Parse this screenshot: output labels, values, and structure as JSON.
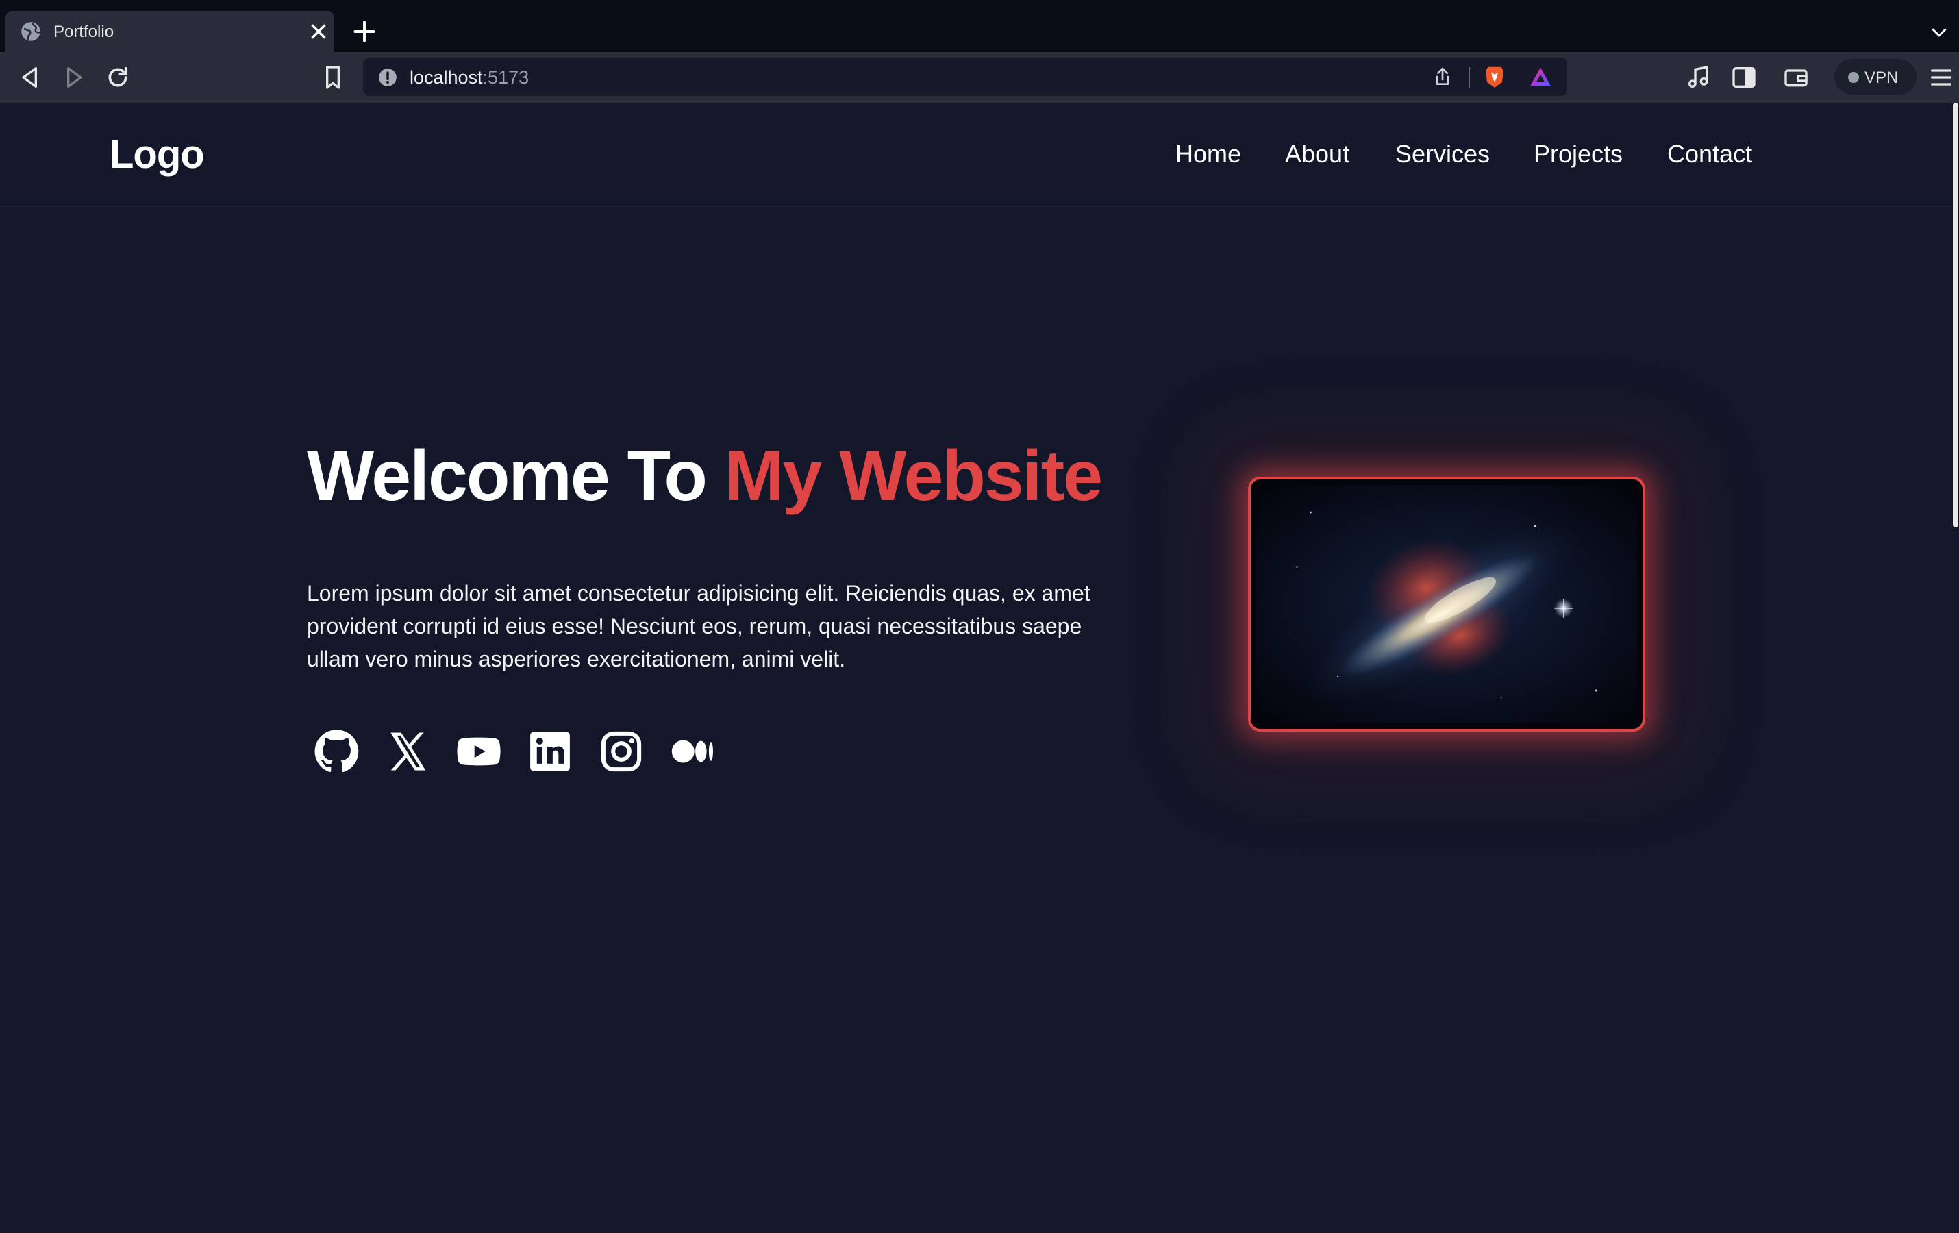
{
  "browser": {
    "tab_title": "Portfolio",
    "url_host": "localhost",
    "url_port": ":5173",
    "vpn_label": "VPN",
    "icons": [
      "globe-icon",
      "close-icon",
      "plus-icon",
      "chevron-down-icon",
      "back-icon",
      "forward-icon",
      "reload-icon",
      "bookmark-icon",
      "info-icon",
      "share-icon",
      "brave-shields-icon",
      "brave-rewards-icon",
      "music-icon",
      "sidebar-icon",
      "wallet-icon",
      "menu-icon"
    ]
  },
  "nav": {
    "logo": "Logo",
    "items": [
      "Home",
      "About",
      "Services",
      "Projects",
      "Contact"
    ]
  },
  "hero": {
    "title_white": "Welcome To ",
    "title_accent": "My Website",
    "description": "Lorem ipsum dolor sit amet consectetur adipisicing elit. Reiciendis quas, ex amet provident corrupti id eius esse! Nesciunt eos, rerum, quasi necessitatibus saepe ullam vero minus asperiores exercitationem, animi velit.",
    "social_icons": [
      "github-icon",
      "x-icon",
      "youtube-icon",
      "linkedin-icon",
      "instagram-icon",
      "medium-icon"
    ]
  },
  "colors": {
    "page_bg": "#131729",
    "accent": "#e04545",
    "tabbar_bg": "#0b0d16",
    "toolbar_bg": "#2a2d39"
  }
}
